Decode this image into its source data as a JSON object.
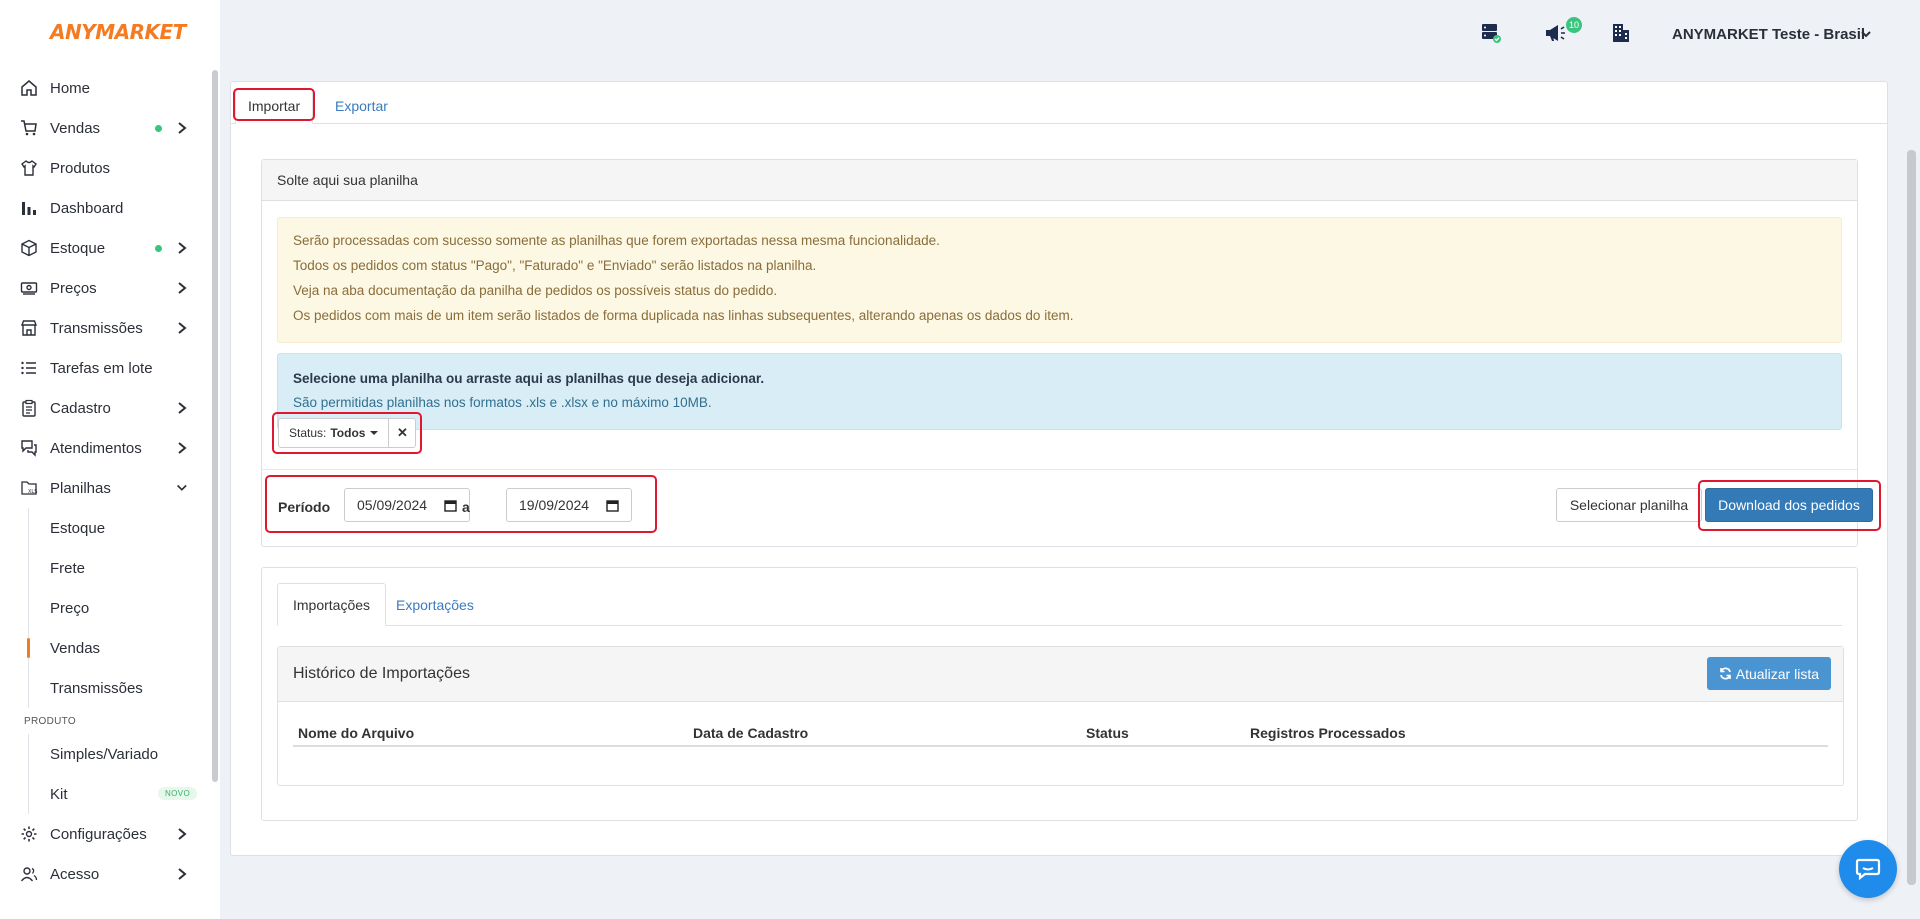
{
  "app": {
    "logo": "ANYMARKET"
  },
  "sidebar": {
    "items": [
      {
        "label": "Home"
      },
      {
        "label": "Vendas"
      },
      {
        "label": "Produtos"
      },
      {
        "label": "Dashboard"
      },
      {
        "label": "Estoque"
      },
      {
        "label": "Preços"
      },
      {
        "label": "Transmissões"
      },
      {
        "label": "Tarefas em lote"
      },
      {
        "label": "Cadastro"
      },
      {
        "label": "Atendimentos"
      },
      {
        "label": "Planilhas"
      },
      {
        "label": "Configurações"
      },
      {
        "label": "Acesso"
      }
    ],
    "planilhas_sub": [
      "Estoque",
      "Frete",
      "Preço",
      "Vendas",
      "Transmissões"
    ],
    "section_produto": "PRODUTO",
    "produto_sub": [
      "Simples/Variado",
      "Kit"
    ],
    "badge_novo": "NOVO",
    "active_sub": "Vendas"
  },
  "header": {
    "notification_count": "10",
    "account": "ANYMARKET Teste - Brasil"
  },
  "main": {
    "tabs": {
      "importar": "Importar",
      "exportar": "Exportar"
    },
    "drop": {
      "title": "Solte aqui sua planilha",
      "warnings": [
        "Serão processadas com sucesso somente as planilhas que forem exportadas nessa mesma funcionalidade.",
        "Todos os pedidos com status \"Pago\", \"Faturado\" e \"Enviado\" serão listados na planilha.",
        "Veja na aba documentação da panilha de pedidos os possíveis status do pedido.",
        "Os pedidos com mais de um item serão listados de forma duplicada nas linhas subsequentes, alterando apenas os dados do item."
      ],
      "info_title": "Selecione uma planilha ou arraste aqui as planilhas que deseja adicionar.",
      "info_text": "São permitidas planilhas nos formatos .xls e .xlsx e no máximo 10MB."
    },
    "filter": {
      "status_label": "Status:",
      "status_value": "Todos"
    },
    "periodo": {
      "label": "Período",
      "from": "05/09/2024",
      "sep": "a",
      "to": "19/09/2024"
    },
    "buttons": {
      "select": "Selecionar planilha",
      "download": "Download dos pedidos"
    },
    "history": {
      "tab_import": "Importações",
      "tab_export": "Exportações",
      "title": "Histórico de Importações",
      "refresh": "Atualizar lista",
      "columns": [
        "Nome do Arquivo",
        "Data de Cadastro",
        "Status",
        "Registros Processados"
      ]
    }
  },
  "colors": {
    "brand": "#f47b20",
    "primary": "#337ab7",
    "highlight": "#e0182f"
  }
}
